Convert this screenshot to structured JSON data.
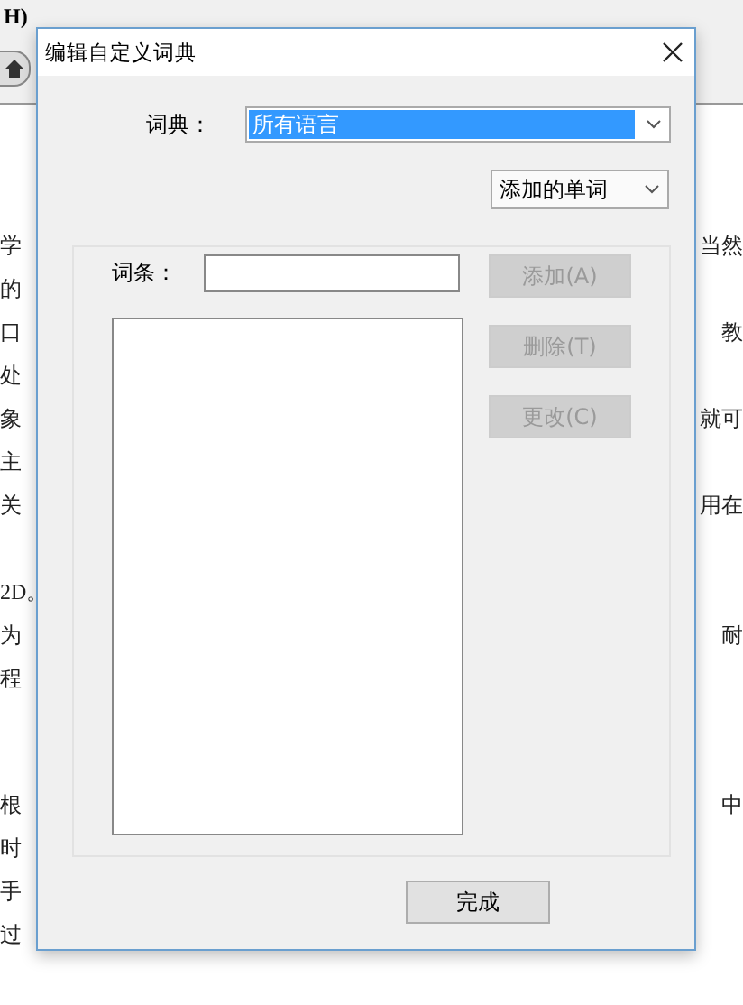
{
  "background_document": {
    "menu_fragment": "H)",
    "paragraphs": [
      [
        {
          "left": "学",
          "right": "当然"
        },
        {
          "left": "的"
        },
        {
          "left": "口",
          "right": "教"
        },
        {
          "left": "处"
        },
        {
          "left": "象",
          "right": "就可"
        },
        {
          "left": "主"
        },
        {
          "left": "关",
          "right": "用在"
        }
      ],
      [
        {
          "left": "2D。"
        },
        {
          "left": "为",
          "right": "耐"
        },
        {
          "left": "程"
        }
      ],
      [
        {
          "left": "根",
          "right": "中"
        },
        {
          "left": "时"
        },
        {
          "left": "手"
        },
        {
          "left": "过"
        }
      ]
    ]
  },
  "dialog": {
    "title": "编辑自定义词典",
    "dictionary_label": "词典：",
    "dictionary_value": "所有语言",
    "filter_value": "添加的单词",
    "entry_label": "词条：",
    "buttons": [
      {
        "label": "添加(A)",
        "disabled": true
      },
      {
        "label": "删除(T)",
        "disabled": true
      },
      {
        "label": "更改(C)",
        "disabled": true
      }
    ],
    "done_button": "完成"
  }
}
